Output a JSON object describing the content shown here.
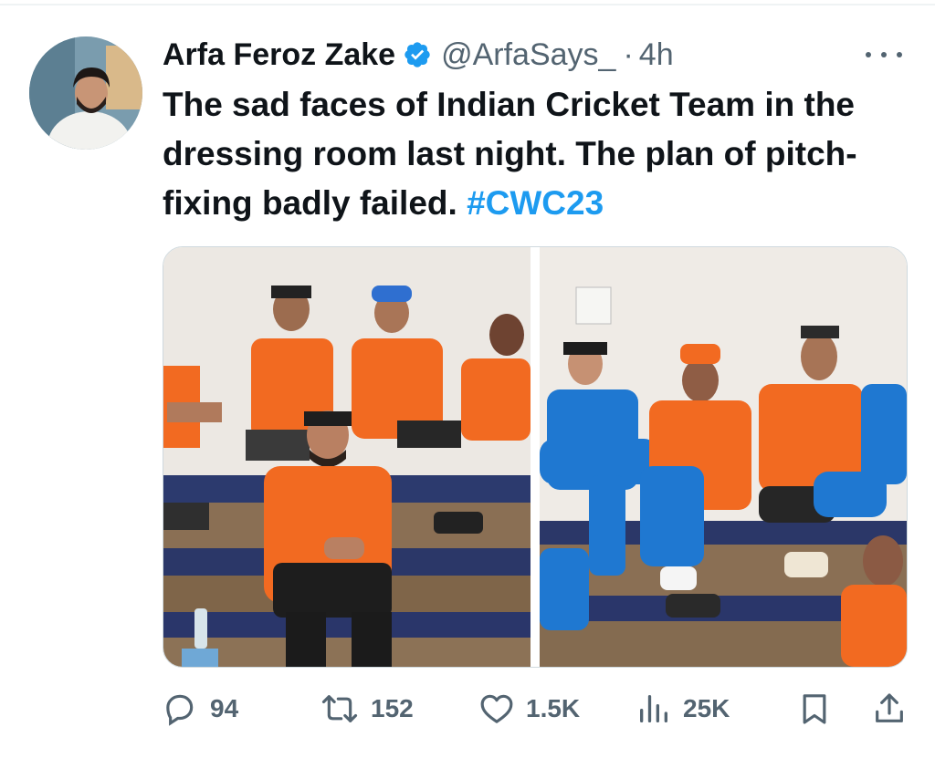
{
  "tweet": {
    "author_name": "Arfa Feroz Zake",
    "handle": "@ArfaSays_",
    "separator": "·",
    "time": "4h",
    "text_main": "The sad faces of Indian Cricket Team in the dressing room last night. The plan of pitch-fixing badly failed.",
    "hashtag": "#CWC23"
  },
  "actions": {
    "replies": "94",
    "reposts": "152",
    "likes": "1.5K",
    "views": "25K"
  },
  "icons": {
    "verified": "verified-badge-icon",
    "more": "more-icon",
    "reply": "reply-icon",
    "repost": "repost-icon",
    "like": "heart-icon",
    "views": "views-icon",
    "bookmark": "bookmark-icon",
    "share": "share-icon"
  },
  "colors": {
    "accent": "#1d9bf0",
    "secondary_text": "#536471",
    "jersey_orange": "#f26a21",
    "jersey_blue": "#1f78d1"
  }
}
